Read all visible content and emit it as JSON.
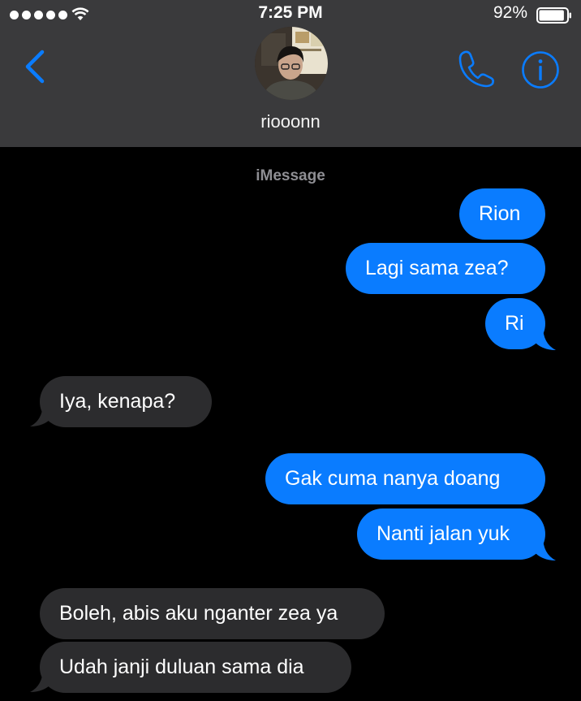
{
  "status_bar": {
    "time": "7:25 PM",
    "battery_percent": "92%",
    "battery_level": 0.92,
    "signal_dots": 5
  },
  "nav": {
    "contact_name": "riooonn",
    "back_icon": "chevron-left-icon",
    "call_icon": "phone-icon",
    "info_icon": "info-icon",
    "accent_color": "#0a7cff"
  },
  "thread": {
    "service_label": "iMessage",
    "messages": [
      {
        "direction": "outgoing",
        "text": "Rion"
      },
      {
        "direction": "outgoing",
        "text": "Lagi sama zea?"
      },
      {
        "direction": "outgoing",
        "text": "Ri"
      },
      {
        "direction": "incoming",
        "text": "Iya, kenapa?"
      },
      {
        "direction": "outgoing",
        "text": "Gak cuma nanya doang"
      },
      {
        "direction": "outgoing",
        "text": "Nanti jalan yuk"
      },
      {
        "direction": "incoming",
        "text": "Boleh, abis aku nganter zea ya"
      },
      {
        "direction": "incoming",
        "text": "Udah janji duluan sama dia"
      }
    ],
    "outgoing_color": "#0a7cff",
    "incoming_color": "#2c2c2e"
  }
}
